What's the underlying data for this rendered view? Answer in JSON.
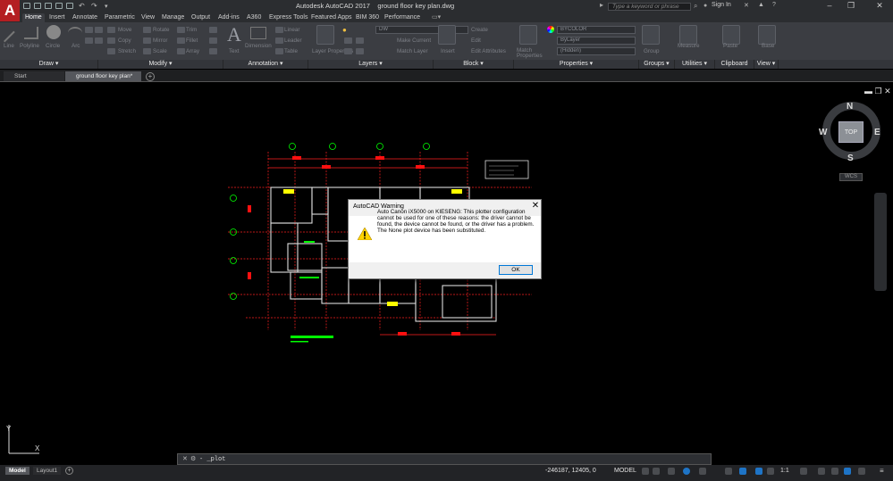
{
  "app": {
    "title": "Autodesk AutoCAD 2017",
    "document": "ground floor key plan.dwg",
    "logo": "A",
    "search_placeholder": "Type a keyword or phrase",
    "signin": "Sign In",
    "window": {
      "minimize": "–",
      "restore": "❐",
      "close": "✕"
    }
  },
  "ribbon_tabs": [
    "Home",
    "Insert",
    "Annotate",
    "Parametric",
    "View",
    "Manage",
    "Output",
    "Add-ins",
    "A360",
    "Express Tools",
    "Featured Apps",
    "BIM 360",
    "Performance"
  ],
  "ribbon_panels": [
    "Draw ▾",
    "Modify ▾",
    "Annotation ▾",
    "Layers ▾",
    "Block ▾",
    "Properties ▾",
    "Groups ▾",
    "Utilities ▾",
    "Clipboard",
    "View ▾"
  ],
  "ribbon_tools": {
    "draw": [
      "Line",
      "Polyline",
      "Circle",
      "Arc"
    ],
    "modify": [
      "Move",
      "Rotate",
      "Trim",
      "Copy",
      "Mirror",
      "Fillet",
      "Stretch",
      "Scale",
      "Array"
    ],
    "annotation": [
      "Text",
      "Dimension",
      "Linear",
      "Leader",
      "Table"
    ],
    "layers": {
      "current": "DW",
      "buttons": [
        "Layer Properties",
        "Make Current",
        "Match Layer"
      ]
    },
    "block": [
      "Insert",
      "Create",
      "Edit",
      "Edit Attributes"
    ],
    "properties": {
      "color": "BYCOLOR",
      "linetype": "ByLayer",
      "lineweight": "ByLayer",
      "plot": "(Hidden)",
      "buttons": [
        "Match Properties"
      ]
    },
    "groups": [
      "Group"
    ],
    "utilities": [
      "Measure"
    ],
    "clipboard": [
      "Paste"
    ],
    "view": [
      "Base"
    ]
  },
  "file_tabs": [
    "Start",
    "ground floor key plan*"
  ],
  "viewcube": {
    "n": "N",
    "s": "S",
    "e": "E",
    "w": "W",
    "face": "TOP",
    "wcs": "WCS"
  },
  "dialog": {
    "title": "AutoCAD Warning",
    "message": "Auto Canon iX5000 on KIESENG: This plotter configuration cannot be used for one of these reasons: the driver cannot be found, the device cannot be found, or the driver has a problem. The None plot device has been substituted.",
    "ok": "OK",
    "icon": "warning-icon"
  },
  "command_line": {
    "text": "- _plot"
  },
  "layout_tabs": [
    "Model",
    "Layout1"
  ],
  "status": {
    "coords": "-246187, 12405, 0",
    "space": "MODEL",
    "scale": "1:1"
  },
  "colors": {
    "accent": "#b41e22",
    "drawing_red": "#ff2020",
    "drawing_green": "#00ff00",
    "warning_yellow": "#ffd200"
  }
}
